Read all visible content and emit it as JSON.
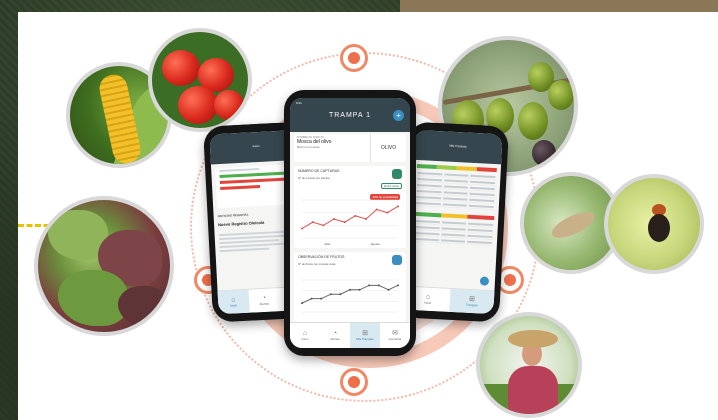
{
  "colors": {
    "accent_orange": "#ee6f4b",
    "ring_light": "#f7c9b8",
    "header_dark": "#36464e",
    "primary_blue": "#3a8ec1",
    "green": "#2e8a67",
    "alert_red": "#e2443c"
  },
  "main_phone": {
    "title": "TRAMPA 1",
    "header_small": "9:41",
    "crop": {
      "key": "NOMBRE DE INSECTO",
      "name": "Mosca del olivo",
      "scientific": "Bactrocera oleae",
      "crop_label": "OLIVO"
    },
    "captures": {
      "title": "NÚMERO DE CAPTURAS",
      "subtitle": "Nº de moscas por trampa",
      "selector": "Media diaria",
      "badge": "30% de probabilidad",
      "x_labels": [
        "Julio",
        "Agosto"
      ],
      "values": [
        3,
        5,
        4,
        6,
        5,
        7,
        6,
        9,
        8,
        10
      ]
    },
    "observation": {
      "title": "OBSERVACIÓN DE FRUTOS",
      "subtitle": "Nº de frutos con moscas vivas",
      "values": [
        2,
        3,
        3,
        4,
        4,
        5,
        5,
        6,
        6,
        5,
        6
      ]
    },
    "tabs": [
      {
        "label": "Inicio",
        "icon": "home-icon",
        "glyph": "⌂"
      },
      {
        "label": "Alertas",
        "icon": "clock-icon",
        "glyph": "◔"
      },
      {
        "label": "Mis Trampas",
        "icon": "trap-icon",
        "glyph": "⊞"
      },
      {
        "label": "Contactar",
        "icon": "chat-icon",
        "glyph": "✉"
      }
    ]
  },
  "left_phone": {
    "header_title": "Inicio",
    "section_title": "NOTICIAS REGIONAL",
    "headline": "Nuevo Registro Oleícola",
    "tabs": [
      {
        "label": "Inicio",
        "glyph": "⌂"
      },
      {
        "label": "Alertas",
        "glyph": "◔"
      },
      {
        "label": "Trampas",
        "glyph": "⊞"
      }
    ]
  },
  "right_phone": {
    "header_title": "Mis Trampas",
    "tabs": [
      {
        "label": "Inicio",
        "glyph": "⌂"
      },
      {
        "label": "Trampas",
        "glyph": "⊞"
      }
    ]
  }
}
